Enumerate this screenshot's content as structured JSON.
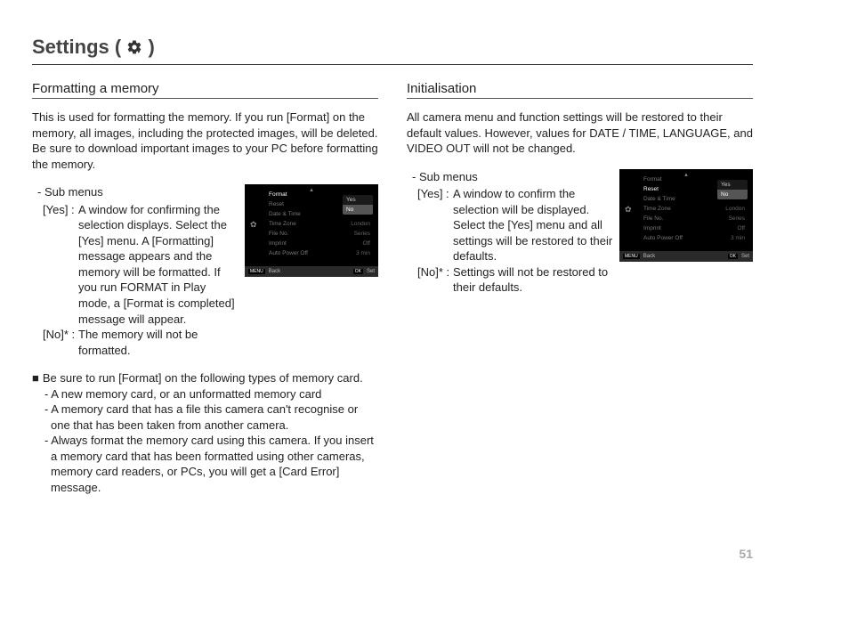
{
  "title": {
    "prefix": "Settings ( ",
    "suffix": " )"
  },
  "page_number": "51",
  "left": {
    "heading": "Formatting a memory",
    "intro": "This is used for formatting the memory. If you run [Format] on the memory, all images, including the protected images, will be deleted. Be sure to download important images to your PC before formatting the memory.",
    "sub_label": "- Sub menus",
    "yes_key": "[Yes]  :",
    "yes_desc": "A window for confirming the selection displays. Select the [Yes] menu. A [Formatting] message appears and the memory will be formatted. If you run FORMAT in Play mode, a [Format is completed] message will appear.",
    "no_key": "[No]* :",
    "no_desc": "The memory will not be formatted.",
    "note_head": "Be sure to run [Format] on the following types of memory card.",
    "note1": "- A new memory card, or an unformatted memory card",
    "note2": "- A memory card that has a file this camera can't recognise or one that has been taken from another camera.",
    "note3": "- Always format the memory card using this camera. If you insert a memory card that has been formatted using other cameras, memory card readers, or PCs, you will get a [Card Error] message."
  },
  "right": {
    "heading": "Initialisation",
    "intro": "All camera menu and function settings will be restored to their default values. However, values for DATE / TIME, LANGUAGE, and VIDEO OUT will not be changed.",
    "sub_label": "- Sub menus",
    "yes_key": "[Yes]  :",
    "yes_desc": "A window to confirm the selection will be displayed. Select the [Yes] menu and all settings will be restored to their defaults.",
    "no_key": "[No]*  :",
    "no_desc": "Settings will not be restored to their defaults."
  },
  "lcd": {
    "items": [
      {
        "l": "Format",
        "r": ""
      },
      {
        "l": "Reset",
        "r": ""
      },
      {
        "l": "Date & Time",
        "r": ""
      },
      {
        "l": "Time Zone",
        "r": "London"
      },
      {
        "l": "File No.",
        "r": "Series"
      },
      {
        "l": "Imprint",
        "r": "Off"
      },
      {
        "l": "Auto Power Off",
        "r": "3 min"
      }
    ],
    "popup_yes": "Yes",
    "popup_no": "No",
    "footer_menu": "MENU",
    "footer_back": "Back",
    "footer_ok": "OK",
    "footer_set": "Set",
    "highlight_left": 0,
    "highlight_right": 1
  }
}
